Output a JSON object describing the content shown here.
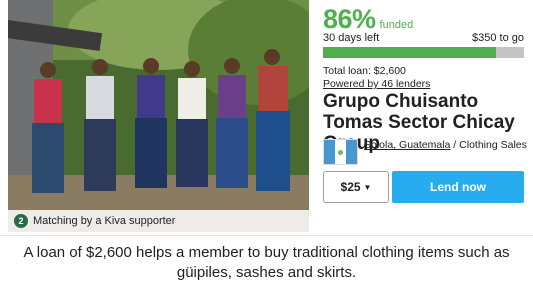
{
  "progress": {
    "percent_label": "86%",
    "funded_label": "funded",
    "fraction": 0.86
  },
  "time_left": "30 days left",
  "to_go": "$350 to go",
  "total_loan": "Total loan: $2,600",
  "lenders": "Powered by 46 lenders",
  "borrower_name": "Grupo Chuisanto Tomas Sector Chicay Group",
  "location": "Solola, Guatemala",
  "location_separator": " / ",
  "sector": "Clothing Sales",
  "amount": "$25",
  "lend_button": "Lend now",
  "matching": {
    "badge": "2",
    "text": "Matching by a Kiva supporter"
  },
  "summary": "A loan of $2,600 helps a member to buy traditional clothing items such as güipiles, sashes and skirts.",
  "icons": {
    "flag": "guatemala-flag-icon",
    "caret": "caret-down-icon",
    "badge": "matching-2x-badge-icon"
  },
  "colors": {
    "green": "#4faf4e",
    "blue_button": "#28acf0",
    "bar_bg": "#c4c4c4"
  }
}
